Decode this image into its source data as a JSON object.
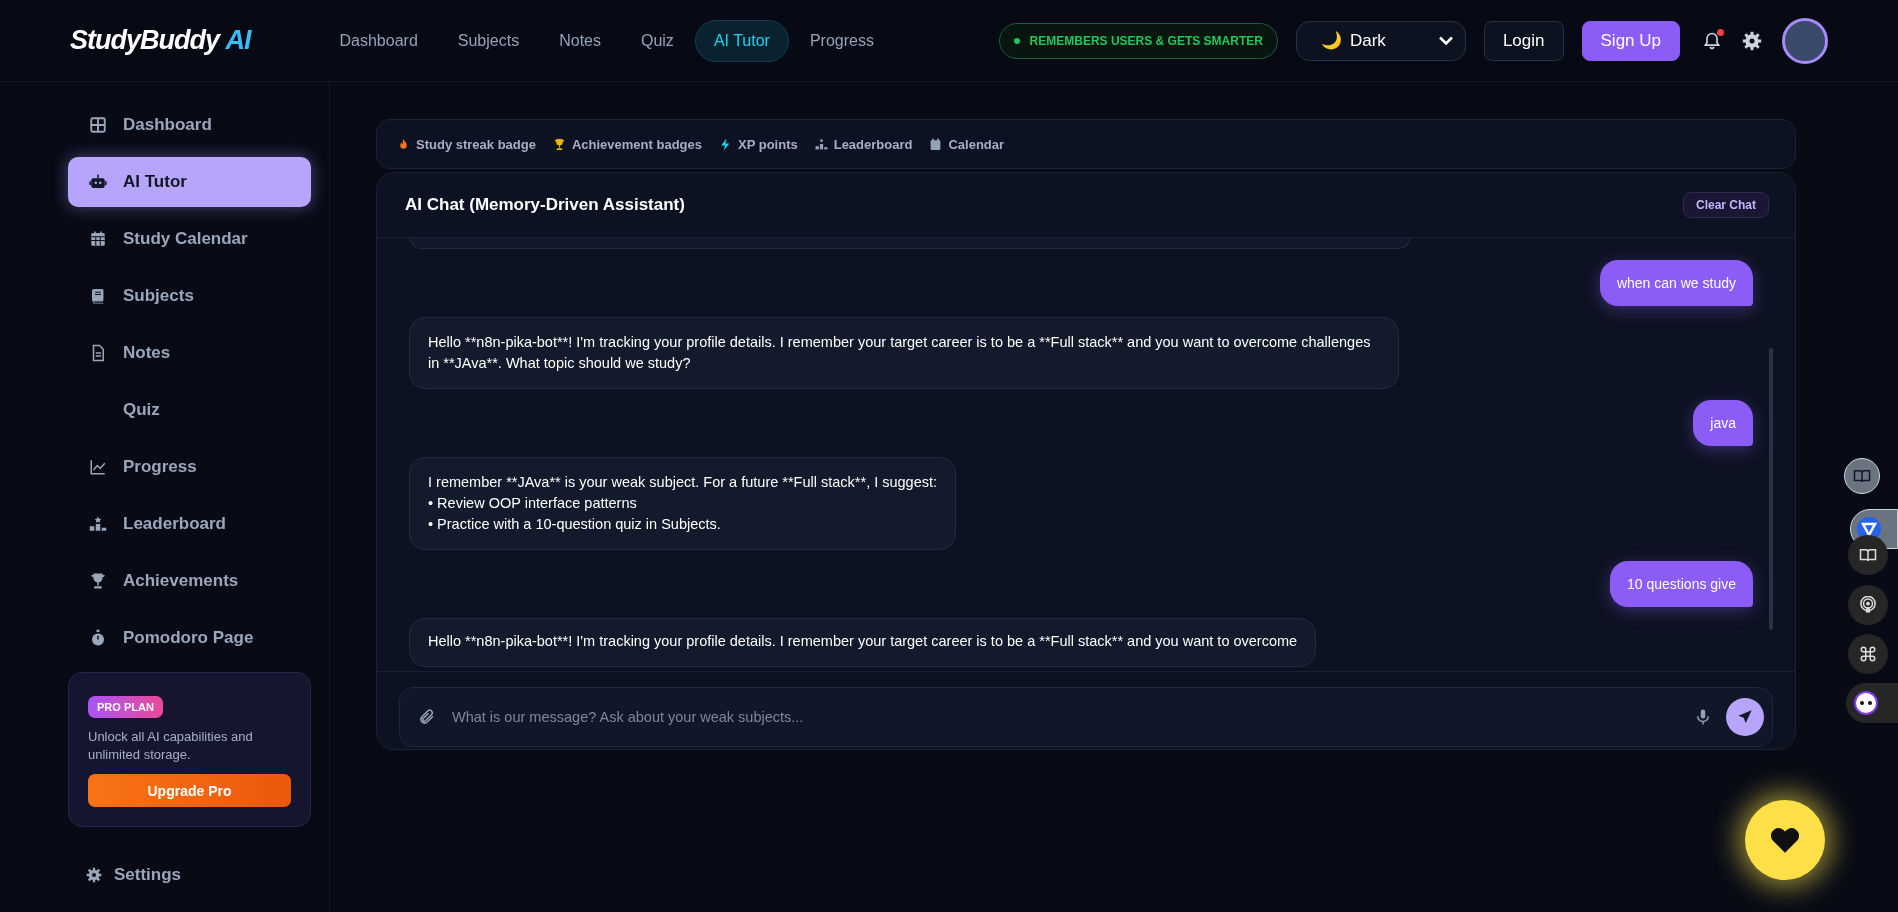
{
  "header": {
    "logo": {
      "text": "StudyBuddy",
      "accent": "AI"
    },
    "nav": [
      {
        "label": "Dashboard",
        "selected": false
      },
      {
        "label": "Subjects",
        "selected": false
      },
      {
        "label": "Notes",
        "selected": false
      },
      {
        "label": "Quiz",
        "selected": false
      },
      {
        "label": "AI Tutor",
        "selected": true
      },
      {
        "label": "Progress",
        "selected": false
      }
    ],
    "status_pill": "REMEMBERS USERS & GETS SMARTER",
    "theme": {
      "icon": "🌙",
      "value": "Dark"
    },
    "login": "Login",
    "signup": "Sign Up",
    "notification_dot": true
  },
  "sidebar": {
    "items": [
      {
        "label": "Dashboard",
        "selected": false
      },
      {
        "label": "AI Tutor",
        "selected": true
      },
      {
        "label": "Study Calendar",
        "selected": false
      },
      {
        "label": "Subjects",
        "selected": false
      },
      {
        "label": "Notes",
        "selected": false
      },
      {
        "label": "Quiz",
        "selected": false
      },
      {
        "label": "Progress",
        "selected": false
      },
      {
        "label": "Leaderboard",
        "selected": false
      },
      {
        "label": "Achievements",
        "selected": false
      },
      {
        "label": "Pomodoro Page",
        "selected": false
      }
    ],
    "pro": {
      "badge": "PRO PLAN",
      "text": "Unlock all AI capabilities and unlimited storage.",
      "button": "Upgrade Pro"
    },
    "settings": "Settings"
  },
  "badges": [
    "Study streak badge",
    "Achievement badges",
    "XP points",
    "Leaderboard",
    "Calendar"
  ],
  "chat": {
    "title": "AI Chat (Memory-Driven Assistant)",
    "clear": "Clear Chat",
    "messages": [
      {
        "kind": "edge"
      },
      {
        "kind": "user",
        "text": "when can we study"
      },
      {
        "kind": "ai",
        "lines": [
          "Hello **n8n-pika-bot**! I'm tracking your profile details. I remember your target career is to be a **Full stack** and you want to overcome challenges in **JAva**. What topic should we study?"
        ]
      },
      {
        "kind": "user",
        "text": "java"
      },
      {
        "kind": "ai",
        "lines": [
          "I remember **JAva** is your weak subject. For a future **Full stack**, I suggest:",
          "• Review OOP interface patterns",
          "• Practice with a 10-question quiz in Subjects."
        ]
      },
      {
        "kind": "user",
        "text": "10 questions give"
      },
      {
        "kind": "ai",
        "lines": [
          "Hello **n8n-pika-bot**! I'm tracking your profile details. I remember your target career is to be a **Full stack** and you want to overcome"
        ]
      }
    ],
    "input": {
      "placeholder": "What is our message? Ask about your weak subjects..."
    }
  }
}
